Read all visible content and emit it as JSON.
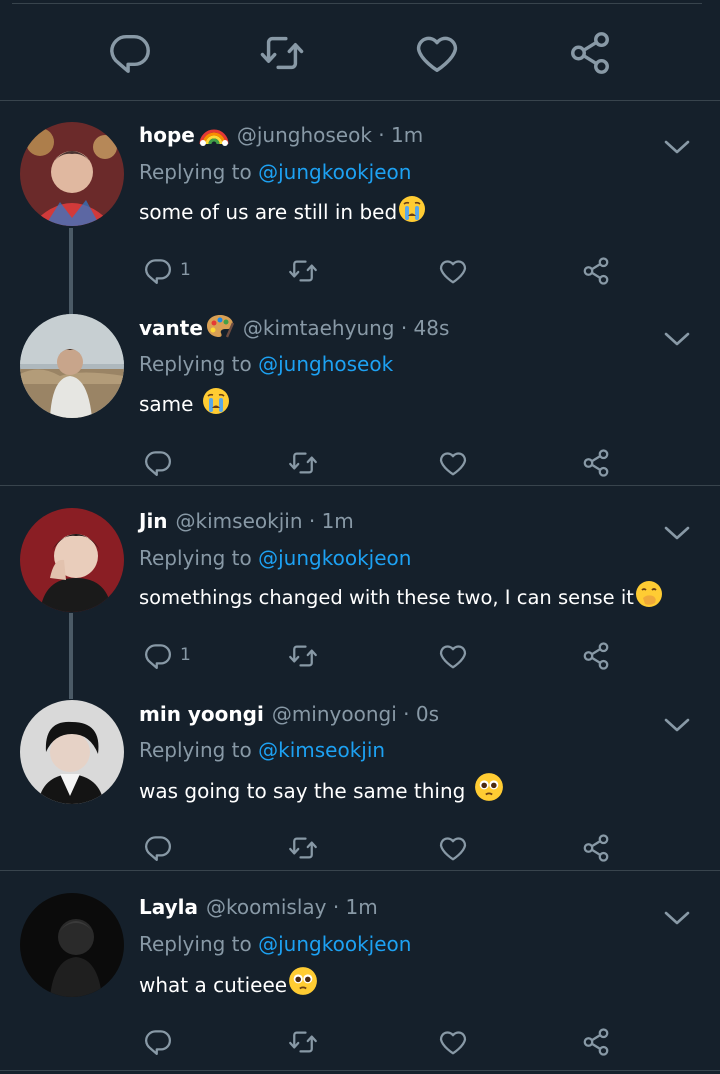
{
  "colors": {
    "background": "#15202b",
    "separator": "#38444d",
    "secondary_text": "#8899a6",
    "mention": "#1da1f2",
    "icon": "#8899a6"
  },
  "tweets": [
    {
      "name": "hope",
      "name_emoji": "rainbow-icon",
      "handle_time": "@junghoseok · 1m",
      "replying_prefix": "Replying to ",
      "replying_handle": "@jungkookjeon",
      "text": "some of us are still in bed",
      "text_emoji": "crying-face-icon",
      "reply_count": "1"
    },
    {
      "name": "vante",
      "name_emoji": "palette-icon",
      "handle_time": "@kimtaehyung · 48s",
      "replying_prefix": "Replying to ",
      "replying_handle": "@junghoseok",
      "text": "same ",
      "text_emoji": "crying-face-icon",
      "reply_count": ""
    },
    {
      "name": "Jin",
      "name_emoji": "",
      "handle_time": "@kimseokjin · 1m",
      "replying_prefix": "Replying to ",
      "replying_handle": "@jungkookjeon",
      "text": "somethings changed with these two, I can sense it",
      "text_emoji": "hand-over-mouth-icon",
      "reply_count": "1"
    },
    {
      "name": "min yoongi",
      "name_emoji": "",
      "handle_time": "@minyoongi · 0s",
      "replying_prefix": "Replying to ",
      "replying_handle": "@kimseokjin",
      "text": "was going to say the same thing ",
      "text_emoji": "pleading-face-icon",
      "reply_count": ""
    },
    {
      "name": "Layla",
      "name_emoji": "",
      "handle_time": "@koomislay · 1m",
      "replying_prefix": "Replying to ",
      "replying_handle": "@jungkookjeon",
      "text": "what a cutieee",
      "text_emoji": "pleading-face-icon",
      "reply_count": ""
    }
  ]
}
